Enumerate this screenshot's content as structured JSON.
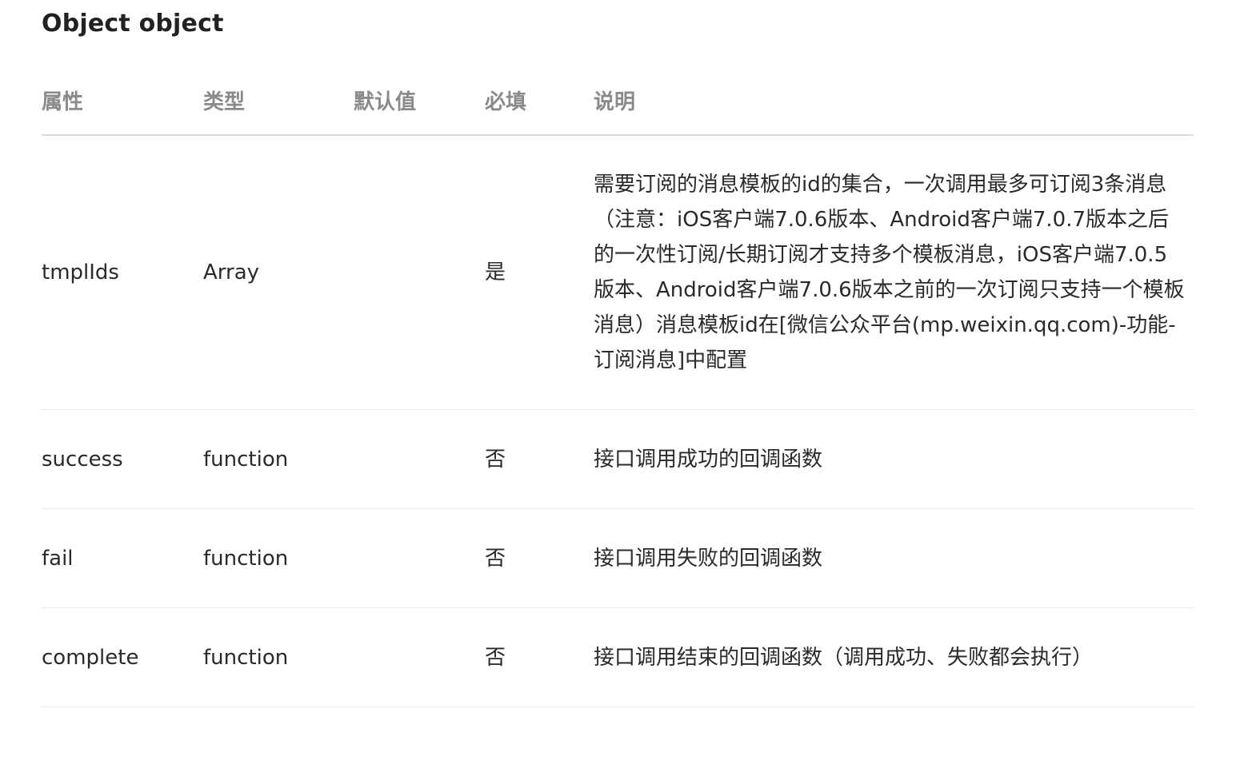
{
  "title": "Object object",
  "table": {
    "headers": {
      "property": "属性",
      "type": "类型",
      "default": "默认值",
      "required": "必填",
      "description": "说明"
    },
    "rows": [
      {
        "property": "tmplIds",
        "type": "Array",
        "default": "",
        "required": "是",
        "description": "需要订阅的消息模板的id的集合，一次调用最多可订阅3条消息（注意：iOS客户端7.0.6版本、Android客户端7.0.7版本之后的一次性订阅/长期订阅才支持多个模板消息，iOS客户端7.0.5版本、Android客户端7.0.6版本之前的一次订阅只支持一个模板消息）消息模板id在[微信公众平台(mp.weixin.qq.com)-功能-订阅消息]中配置"
      },
      {
        "property": "success",
        "type": "function",
        "default": "",
        "required": "否",
        "description": "接口调用成功的回调函数"
      },
      {
        "property": "fail",
        "type": "function",
        "default": "",
        "required": "否",
        "description": "接口调用失败的回调函数"
      },
      {
        "property": "complete",
        "type": "function",
        "default": "",
        "required": "否",
        "description": "接口调用结束的回调函数（调用成功、失败都会执行）"
      }
    ]
  }
}
